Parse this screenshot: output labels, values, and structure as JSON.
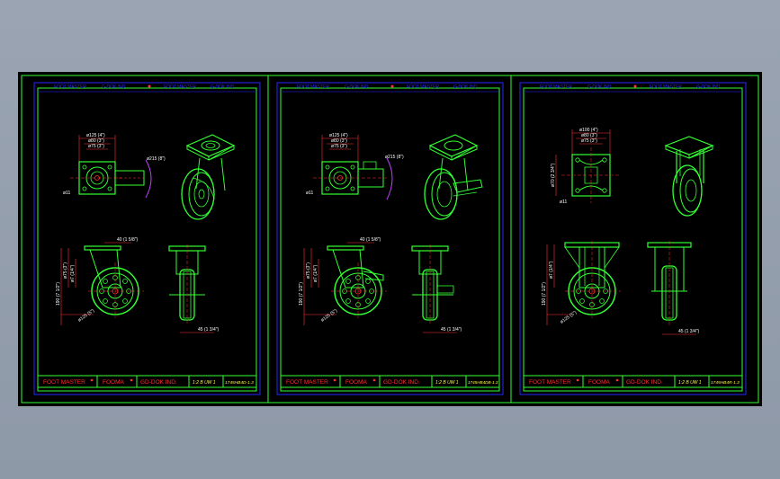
{
  "sheets": [
    {
      "header": {
        "left_a": "FOOT MASTER",
        "left_b": "G-DOK IND",
        "right_a": "FOOT MASTER",
        "right_b": "G-DOK IND"
      },
      "titleblock": {
        "brand1": "FOOT MASTER",
        "brand2": "FOOMA",
        "brand3": "GD-DOK IND.",
        "code": "1:2 B UW 1",
        "drawing_no": "1745HB4D-1.3"
      },
      "dims": {
        "plate_w1": "ø125 (4\")",
        "plate_w2": "ø80 (3\")",
        "plate_w3": "ø75 (3\")",
        "swivel_r": "ø215 (8\")",
        "wheel_offset": "40 (1 5/8\")",
        "height": "190 (7 1/2\")",
        "axle_h": "ø7 (1/4\")",
        "wheel_d": "ø125 (5\")",
        "tread_w": "45 (1 3/4\")",
        "plate_side": "ø11"
      }
    },
    {
      "header": {
        "left_a": "FOOT MASTER",
        "left_b": "G-DOK IND",
        "right_a": "FOOT MASTER",
        "right_b": "G-DOK IND"
      },
      "titleblock": {
        "brand1": "FOOT MASTER",
        "brand2": "FOOMA",
        "brand3": "GD-DOK IND.",
        "code": "1:2 B UW 1",
        "drawing_no": "1745HB4DB-1.3"
      },
      "dims": {
        "plate_w1": "ø125 (4\")",
        "plate_w2": "ø80 (3\")",
        "plate_w3": "ø75 (3\")",
        "swivel_r": "ø215 (8\")",
        "wheel_offset": "40 (1 5/8\")",
        "height": "190 (7 1/2\")",
        "axle_h": "ø7 (1/4\")",
        "wheel_d": "ø125 (5\")",
        "tread_w": "45 (1 3/4\")",
        "plate_side": "ø11"
      }
    },
    {
      "header": {
        "left_a": "FOOT MASTER",
        "left_b": "G-DOK IND",
        "right_a": "FOOT MASTER",
        "right_b": "G-DOK IND"
      },
      "titleblock": {
        "brand1": "FOOT MASTER",
        "brand2": "FOOMA",
        "brand3": "GD-DOK IND.",
        "code": "1:2 B UW 1",
        "drawing_no": "1745HB4R-1.3"
      },
      "dims": {
        "plate_w1": "ø100 (4\")",
        "plate_w2": "ø80 (3\")",
        "plate_w3": "ø75 (3\")",
        "plate_h": "ø70 (2 3/4\")",
        "height": "190 (7 1/2\")",
        "axle_h": "ø7 (1/4\")",
        "wheel_d": "ø125 (5\")",
        "tread_w": "45 (1 3/4\")",
        "plate_side": "ø11"
      }
    }
  ]
}
